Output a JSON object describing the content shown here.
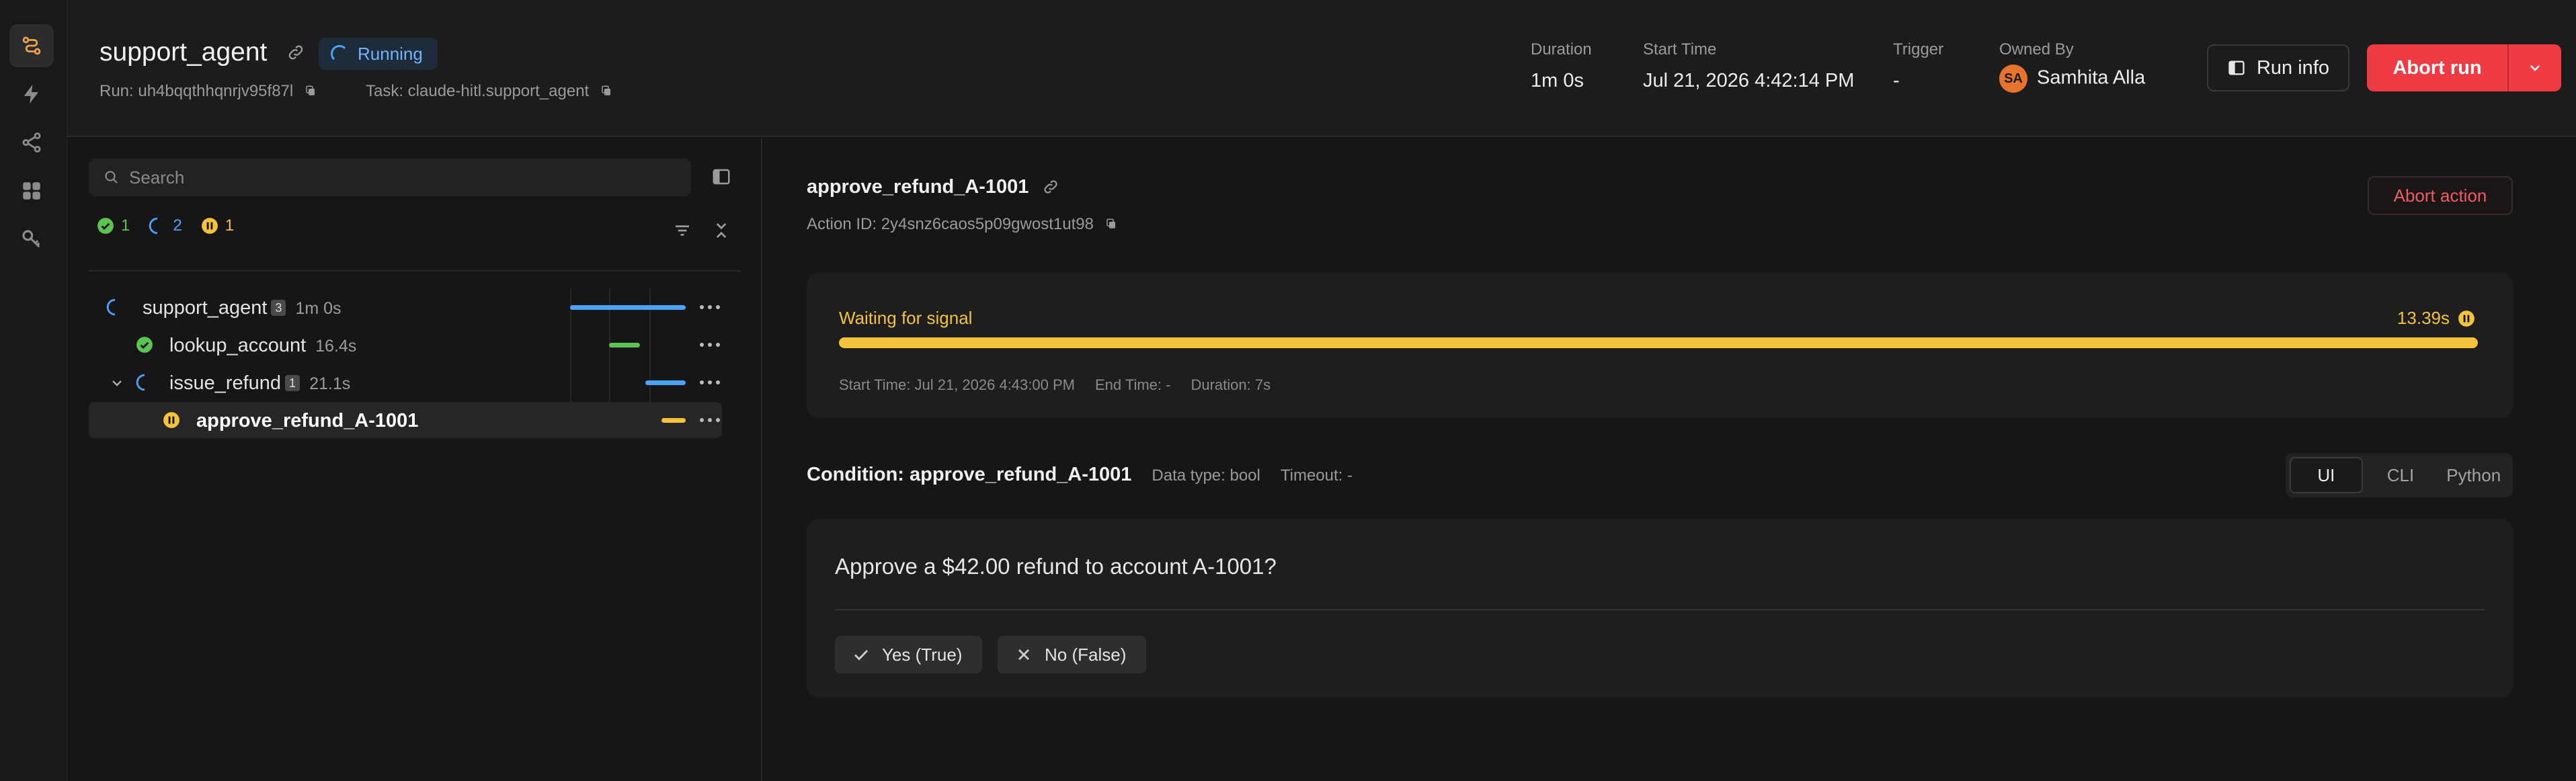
{
  "header": {
    "title": "support_agent",
    "status": "Running",
    "run_label": "Run: uh4bqqthhqnrjv95f87l",
    "task_label": "Task: claude-hitl.support_agent",
    "stats": {
      "duration_label": "Duration",
      "duration_value": "1m 0s",
      "start_label": "Start Time",
      "start_value": "Jul 21, 2026 4:42:14 PM",
      "trigger_label": "Trigger",
      "trigger_value": "-",
      "owner_label": "Owned By",
      "owner_initials": "SA",
      "owner_name": "Samhita Alla"
    },
    "run_info_label": "Run info",
    "abort_label": "Abort run"
  },
  "search": {
    "placeholder": "Search"
  },
  "counts": {
    "succeeded": "1",
    "running": "2",
    "waiting": "1"
  },
  "tree": [
    {
      "name": "support_agent",
      "badge": "3",
      "duration": "1m 0s",
      "status": "running"
    },
    {
      "name": "lookup_account",
      "badge": "",
      "duration": "16.4s",
      "status": "succeeded"
    },
    {
      "name": "issue_refund",
      "badge": "1",
      "duration": "21.1s",
      "status": "running"
    },
    {
      "name": "approve_refund_A-1001",
      "badge": "",
      "duration": "",
      "status": "waiting"
    }
  ],
  "action": {
    "title": "approve_refund_A-1001",
    "id_label": "Action ID: 2y4snz6caos5p09gwost1ut98",
    "abort_label": "Abort action"
  },
  "signal": {
    "status": "Waiting for signal",
    "elapsed": "13.39s",
    "progress": 1.0,
    "start": "Start Time: Jul 21, 2026 4:43:00 PM",
    "end": "End Time: -",
    "duration": "Duration: 7s"
  },
  "condition": {
    "title": "Condition: approve_refund_A-1001",
    "data_type": "Data type:  bool",
    "timeout": "Timeout:  -",
    "tabs": [
      "UI",
      "CLI",
      "Python"
    ],
    "question": "Approve a $42.00 refund to account A-1001?",
    "yes_label": "Yes (True)",
    "no_label": "No (False)"
  },
  "colors": {
    "accent_red": "#ef3b43",
    "running_blue": "#4ea2ff",
    "success_green": "#5cc552",
    "waiting_yellow": "#f4c33a"
  }
}
